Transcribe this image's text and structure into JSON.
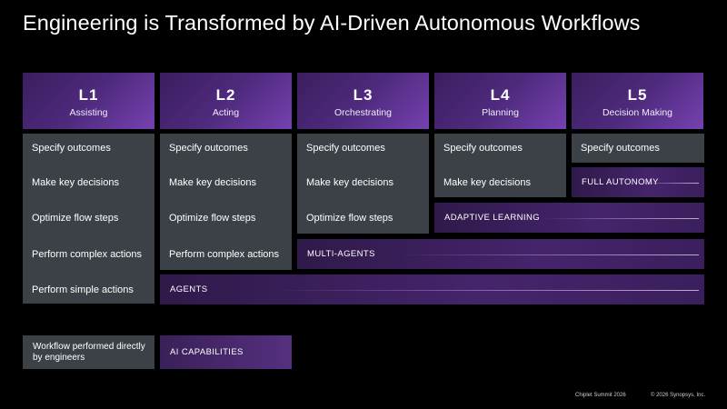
{
  "title": "Engineering is Transformed by AI-Driven Autonomous Workflows",
  "levels": [
    {
      "level": "L1",
      "name": "Assisting"
    },
    {
      "level": "L2",
      "name": "Acting"
    },
    {
      "level": "L3",
      "name": "Orchestrating"
    },
    {
      "level": "L4",
      "name": "Planning"
    },
    {
      "level": "L5",
      "name": "Decision Making"
    }
  ],
  "tasks": {
    "specify": "Specify outcomes",
    "decisions": "Make key decisions",
    "optimize": "Optimize flow steps",
    "complex": "Perform complex actions",
    "simple": "Perform simple actions"
  },
  "capabilities": {
    "full_autonomy": "FULL AUTONOMY",
    "adaptive_learning": "ADAPTIVE LEARNING",
    "multi_agents": "MULTI-AGENTS",
    "agents": "AGENTS"
  },
  "legend": {
    "engineers": "Workflow performed directly by engineers",
    "ai": "AI CAPABILITIES"
  },
  "footer": {
    "event": "Chiplet Summit 2026",
    "copyright": "© 2026 Synopsys, Inc."
  }
}
